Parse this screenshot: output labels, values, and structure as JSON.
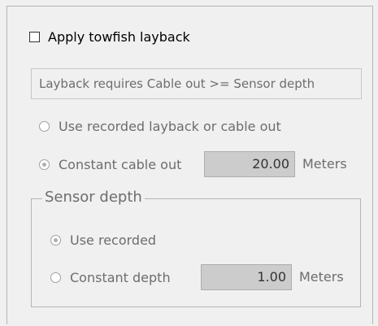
{
  "layback": {
    "checkbox_label": "Apply towfish layback",
    "checked": false,
    "info_text": "Layback requires Cable out >= Sensor depth",
    "options": {
      "recorded_label": "Use recorded layback or cable out",
      "constant_label": "Constant cable out"
    },
    "cable_out_value": "20.00",
    "cable_out_unit": "Meters"
  },
  "sensor_depth": {
    "group_label": "Sensor depth",
    "recorded_label": "Use recorded",
    "constant_label": "Constant depth",
    "depth_value": "1.00",
    "depth_unit": "Meters"
  }
}
